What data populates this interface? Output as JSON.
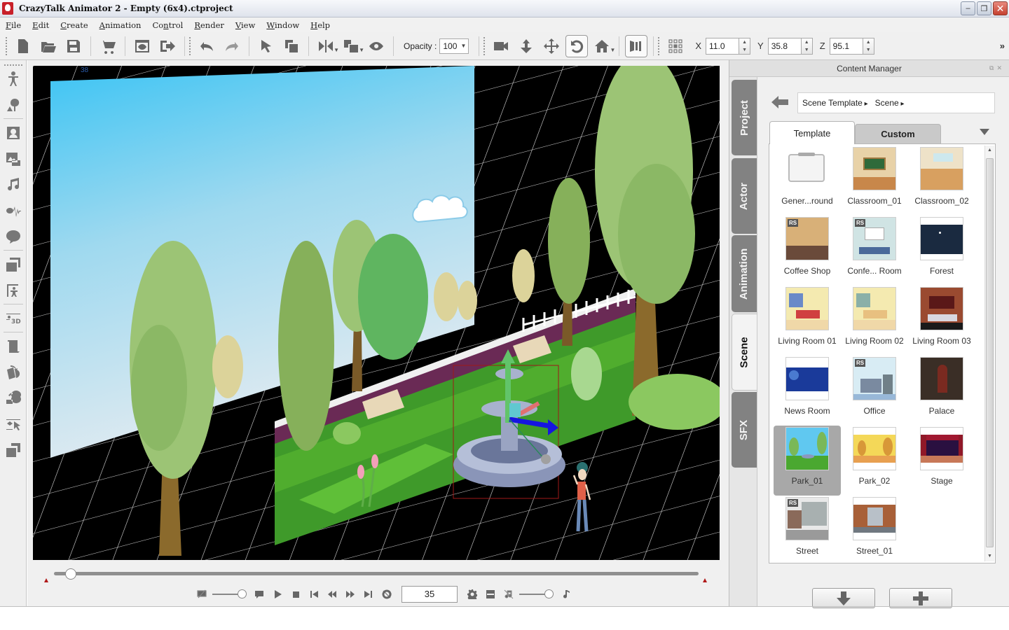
{
  "window": {
    "title": "CrazyTalk Animator 2   - Empty  (6x4).ctproject",
    "minimize": "–",
    "restore": "❐",
    "close": "✕"
  },
  "menu": [
    {
      "label": "File",
      "u": "F",
      "rest": "ile"
    },
    {
      "label": "Edit",
      "u": "E",
      "rest": "dit"
    },
    {
      "label": "Create",
      "u": "C",
      "rest": "reate"
    },
    {
      "label": "Animation",
      "u": "A",
      "rest": "nimation"
    },
    {
      "label": "Control",
      "pre": "Co",
      "u": "n",
      "rest": "trol"
    },
    {
      "label": "Render",
      "u": "R",
      "rest": "ender"
    },
    {
      "label": "View",
      "u": "V",
      "rest": "iew"
    },
    {
      "label": "Window",
      "u": "W",
      "rest": "indow"
    },
    {
      "label": "Help",
      "u": "H",
      "rest": "elp"
    }
  ],
  "toolbar": {
    "opacity_label": "Opacity :",
    "opacity_value": "100",
    "x_label": "X",
    "x_value": "11.0",
    "y_label": "Y",
    "y_value": "35.8",
    "z_label": "Z",
    "z_value": "95.1",
    "more": "»"
  },
  "viewport": {
    "frame_label": "38",
    "scene": "Park_01"
  },
  "timeline": {
    "progress_fraction": 0.02
  },
  "transport": {
    "current_frame": "35",
    "expression_slider": 0.8,
    "volume_slider": 0.8
  },
  "content_manager": {
    "title": "Content Manager",
    "side_tabs": [
      "Project",
      "Actor",
      "Animation",
      "Scene",
      "SFX"
    ],
    "active_tab": "Scene",
    "breadcrumb": [
      "Scene Template",
      "Scene"
    ],
    "tabs": {
      "template": "Template",
      "custom": "Custom"
    },
    "items": [
      {
        "label": "Gener...round",
        "kind": "folder",
        "rs": false
      },
      {
        "label": "Classroom_01",
        "kind": "classroom1",
        "rs": false
      },
      {
        "label": "Classroom_02",
        "kind": "classroom2",
        "rs": false
      },
      {
        "label": "Coffee Shop",
        "kind": "coffee",
        "rs": true
      },
      {
        "label": "Confe... Room",
        "kind": "conference",
        "rs": true
      },
      {
        "label": "Forest",
        "kind": "forest",
        "rs": false
      },
      {
        "label": "Living Room 01",
        "kind": "living1",
        "rs": false
      },
      {
        "label": "Living Room 02",
        "kind": "living2",
        "rs": false
      },
      {
        "label": "Living Room 03",
        "kind": "living3",
        "rs": false
      },
      {
        "label": "News Room",
        "kind": "news",
        "rs": false
      },
      {
        "label": "Office",
        "kind": "office",
        "rs": true
      },
      {
        "label": "Palace",
        "kind": "palace",
        "rs": false
      },
      {
        "label": "Park_01",
        "kind": "park1",
        "rs": false,
        "selected": true
      },
      {
        "label": "Park_02",
        "kind": "park2",
        "rs": false
      },
      {
        "label": "Stage",
        "kind": "stage",
        "rs": false
      },
      {
        "label": "Street",
        "kind": "street",
        "rs": true
      },
      {
        "label": "Street_01",
        "kind": "street1",
        "rs": false
      }
    ],
    "rs_badge": "RS"
  },
  "colors": {
    "sky_top": "#3cc4f4",
    "sky_bottom": "#dfeaf2",
    "grass": "#3f9a2a",
    "tab_inactive": "#828282",
    "selected_tile": "#a8a8a8"
  }
}
